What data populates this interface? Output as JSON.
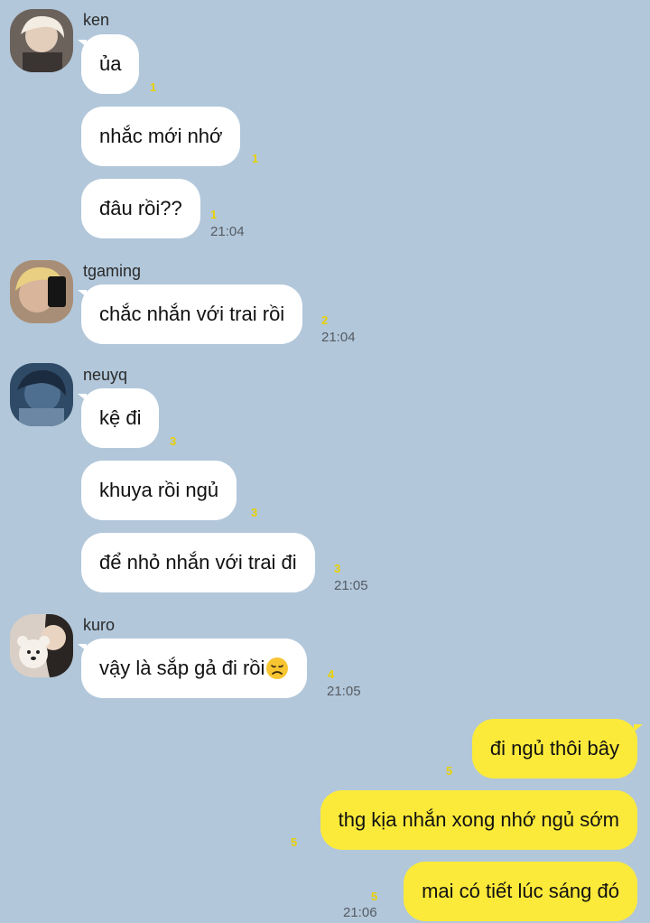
{
  "messages": [
    {
      "sender": "ken",
      "texts": [
        "ủa",
        "nhắc mới nhớ",
        "đâu rồi??"
      ],
      "unread": [
        "1",
        "1",
        "1"
      ],
      "time": "21:04"
    },
    {
      "sender": "tgaming",
      "texts": [
        "chắc nhắn với trai rồi"
      ],
      "unread": [
        "2"
      ],
      "time": "21:04"
    },
    {
      "sender": "neuyq",
      "texts": [
        "kệ đi",
        "khuya rồi ngủ",
        "để nhỏ nhắn với trai đi"
      ],
      "unread": [
        "3",
        "3",
        "3"
      ],
      "time": "21:05"
    },
    {
      "sender": "kuro",
      "texts": [
        "vậy là sắp gả đi rồi"
      ],
      "emoji": "disappointed-face",
      "unread": [
        "4"
      ],
      "time": "21:05"
    }
  ],
  "outgoing": {
    "texts": [
      "đi ngủ thôi bây",
      "thg kịa nhắn xong nhớ ngủ sớm",
      "mai có tiết lúc sáng đó"
    ],
    "unread": [
      "5",
      "5",
      "5"
    ],
    "time": "21:06"
  },
  "colors": {
    "background": "#b2c7da",
    "incoming_bubble": "#ffffff",
    "outgoing_bubble": "#fbea3a",
    "unread_count": "#e8d000"
  }
}
